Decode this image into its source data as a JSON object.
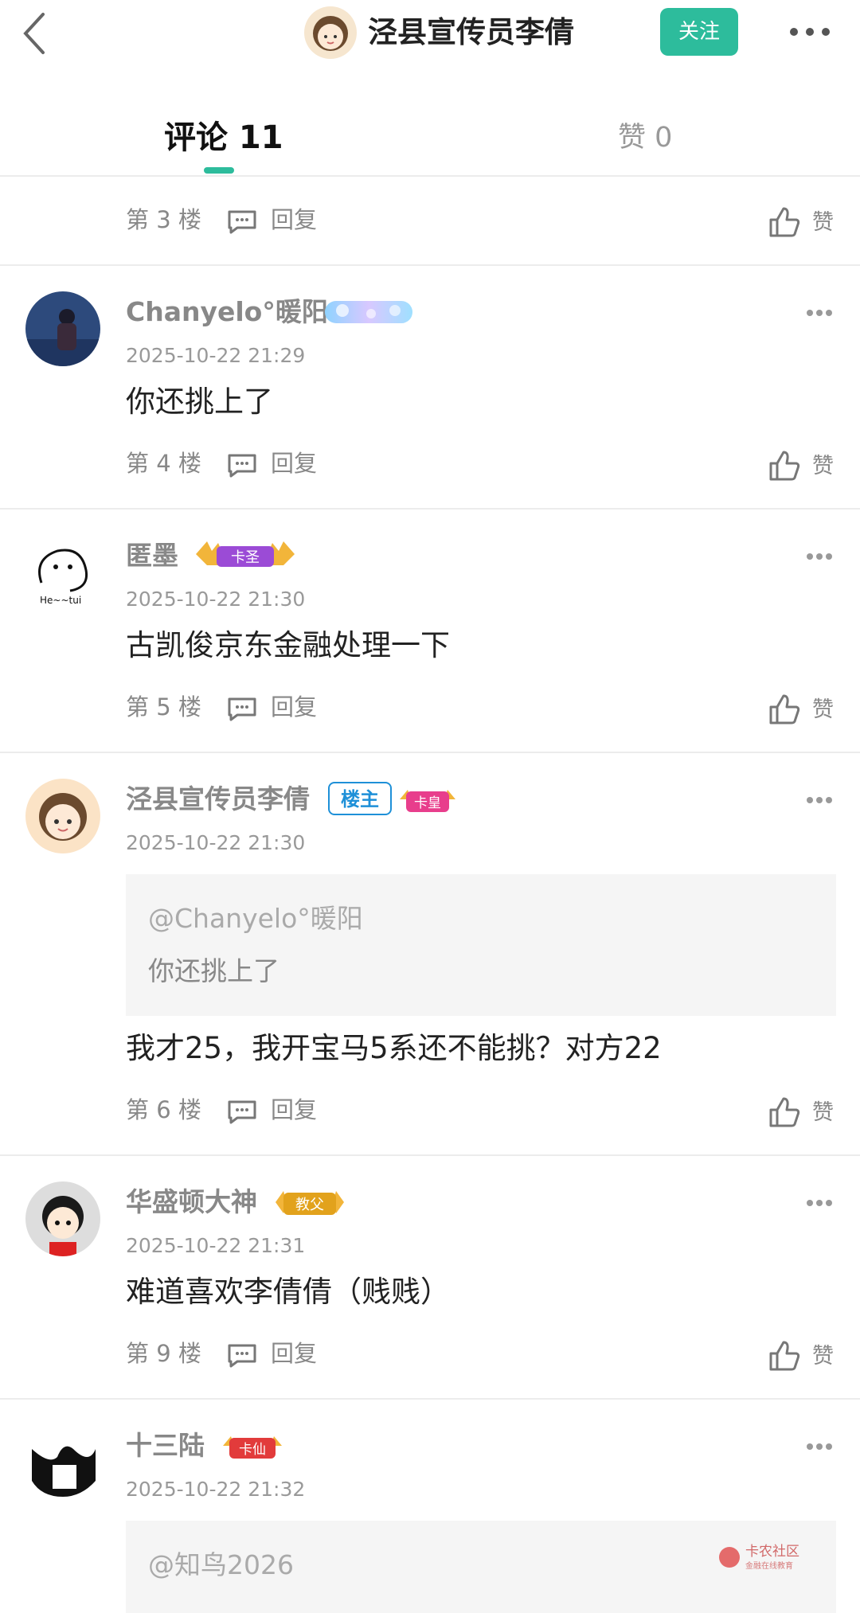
{
  "header": {
    "back_icon": "chevron-left-icon",
    "title": "泾县宣传员李倩",
    "follow_label": "关注",
    "more_icon": "more-horizontal-icon",
    "accent": "#2dbc9c"
  },
  "tabs": [
    {
      "label": "评论 11",
      "active": true
    },
    {
      "label": "赞 0",
      "active": false
    }
  ],
  "comments": [
    {
      "floor": "第 3 楼",
      "reply": "回复",
      "like": "赞"
    },
    {
      "user": "Chanyelo°暖阳",
      "time": "2025-10-22 21:29",
      "content": "你还挑上了",
      "floor": "第 4 楼",
      "reply": "回复",
      "like": "赞",
      "badge": "vip-badge"
    },
    {
      "user": "匿墨",
      "time": "2025-10-22 21:30",
      "content": "古凯俊京东金融处理一下",
      "floor": "第 5 楼",
      "reply": "回复",
      "like": "赞",
      "badge": "卡圣"
    },
    {
      "user": "泾县宣传员李倩",
      "time": "2025-10-22 21:30",
      "owner_tag": "楼主",
      "badge": "卡皇",
      "quote": {
        "user": "@Chanyelo°暖阳",
        "text": "你还挑上了"
      },
      "content": "我才25，我开宝马5系还不能挑？对方22",
      "floor": "第 6 楼",
      "reply": "回复",
      "like": "赞"
    },
    {
      "user": "华盛顿大神",
      "time": "2025-10-22 21:31",
      "content": "难道喜欢李倩倩（贱贱）",
      "floor": "第 9 楼",
      "reply": "回复",
      "like": "赞",
      "badge": "教父"
    },
    {
      "user": "十三陆",
      "time": "2025-10-22 21:32",
      "badge": "卡仙",
      "quote": {
        "user": "@知鸟2026",
        "text": ""
      }
    }
  ],
  "watermark": {
    "name": "卡农社区",
    "sub": "金融在线教育"
  }
}
